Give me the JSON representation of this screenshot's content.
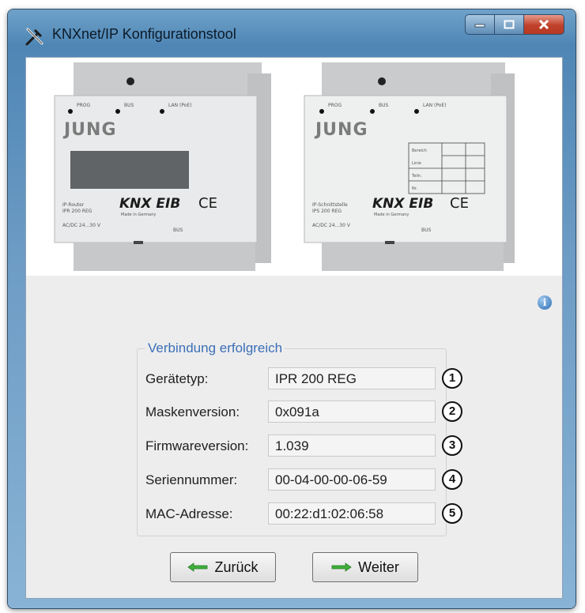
{
  "window": {
    "title": "KNXnet/IP Konfigurationstool"
  },
  "device_photo": {
    "left": {
      "labels": [
        "PROG",
        "BUS",
        "LAN (PoE)"
      ],
      "brand": "JUNG",
      "logo": "KNX EIB",
      "ce": "CE",
      "made_in": "Made in Germany",
      "type": "IP-Router\nIPR 200 REG",
      "voltage": "AC/DC 24...30 V",
      "bus": "BUS"
    },
    "right": {
      "labels": [
        "PROG",
        "BUS",
        "LAN (PoE)"
      ],
      "brand": "JUNG",
      "logo": "KNX EIB",
      "ce": "CE",
      "made_in": "Made in Germany",
      "type": "IP-Schnittstelle\nIPS 200 REG",
      "voltage": "AC/DC 24...30 V",
      "bus": "BUS",
      "grid": [
        "Bereich",
        "Linie",
        "Teiln.",
        "Nr."
      ]
    }
  },
  "info_icon": "info-icon",
  "connection": {
    "title": "Verbindung erfolgreich",
    "rows": [
      {
        "label": "Gerätetyp:",
        "value": "IPR 200 REG",
        "marker": "1"
      },
      {
        "label": "Maskenversion:",
        "value": "0x091a",
        "marker": "2"
      },
      {
        "label": "Firmwareversion:",
        "value": "1.039",
        "marker": "3"
      },
      {
        "label": "Seriennummer:",
        "value": "00-04-00-00-06-59",
        "marker": "4"
      },
      {
        "label": "MAC-Adresse:",
        "value": "00:22:d1:02:06:58",
        "marker": "5"
      }
    ]
  },
  "buttons": {
    "back": "Zurück",
    "next": "Weiter"
  },
  "colors": {
    "titlebar": "#5f90bb",
    "group_title": "#3b6fb6",
    "arrow_green": "#3fae3a",
    "close_button": "#c0402a"
  }
}
